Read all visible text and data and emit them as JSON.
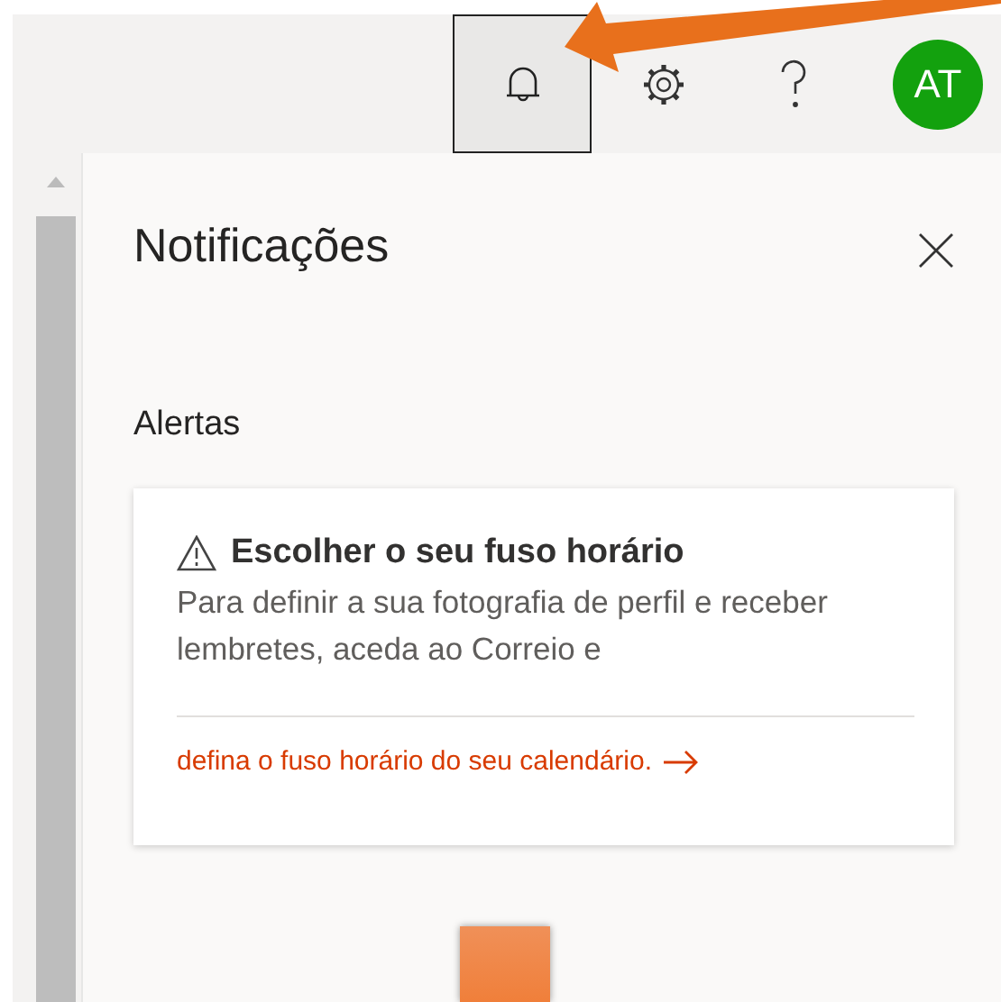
{
  "top_bar": {
    "buttons": [
      {
        "kind": "bell",
        "selected": true
      },
      {
        "kind": "gear",
        "selected": false
      },
      {
        "kind": "help",
        "selected": false
      }
    ],
    "avatar": {
      "initials": "AT",
      "color": "#13a10e"
    }
  },
  "panel": {
    "title": "Notificações",
    "section": "Alertas",
    "alerts": [
      {
        "title": "Escolher o seu fuso horário",
        "body": "Para definir a sua fotografia de perfil e receber lembretes, aceda ao Correio e",
        "link": "defina o fuso horário do seu calendário."
      }
    ]
  }
}
